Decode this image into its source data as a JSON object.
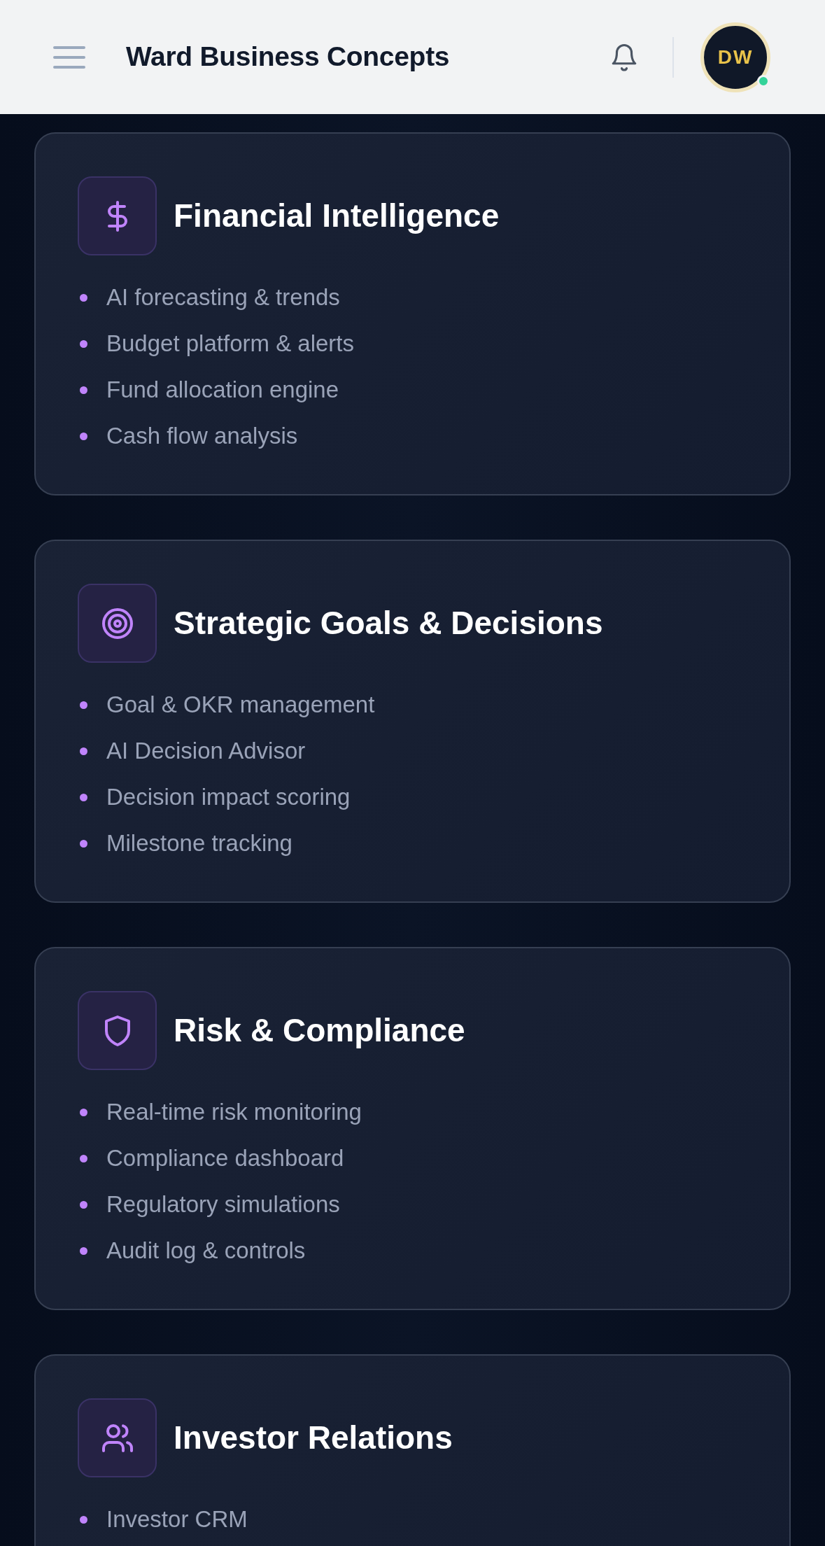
{
  "header": {
    "title": "Ward Business Concepts",
    "avatar": {
      "initials": "DW",
      "online": true
    }
  },
  "cards": [
    {
      "title": "Financial Intelligence",
      "items": [
        "AI forecasting & trends",
        "Budget platform & alerts",
        "Fund allocation engine",
        "Cash flow analysis"
      ]
    },
    {
      "title": "Strategic Goals & Decisions",
      "items": [
        "Goal & OKR management",
        "AI Decision Advisor",
        "Decision impact scoring",
        "Milestone tracking"
      ]
    },
    {
      "title": "Risk & Compliance",
      "items": [
        "Real-time risk monitoring",
        "Compliance dashboard",
        "Regulatory simulations",
        "Audit log & controls"
      ]
    },
    {
      "title": "Investor Relations",
      "items": [
        "Investor CRM"
      ]
    }
  ]
}
